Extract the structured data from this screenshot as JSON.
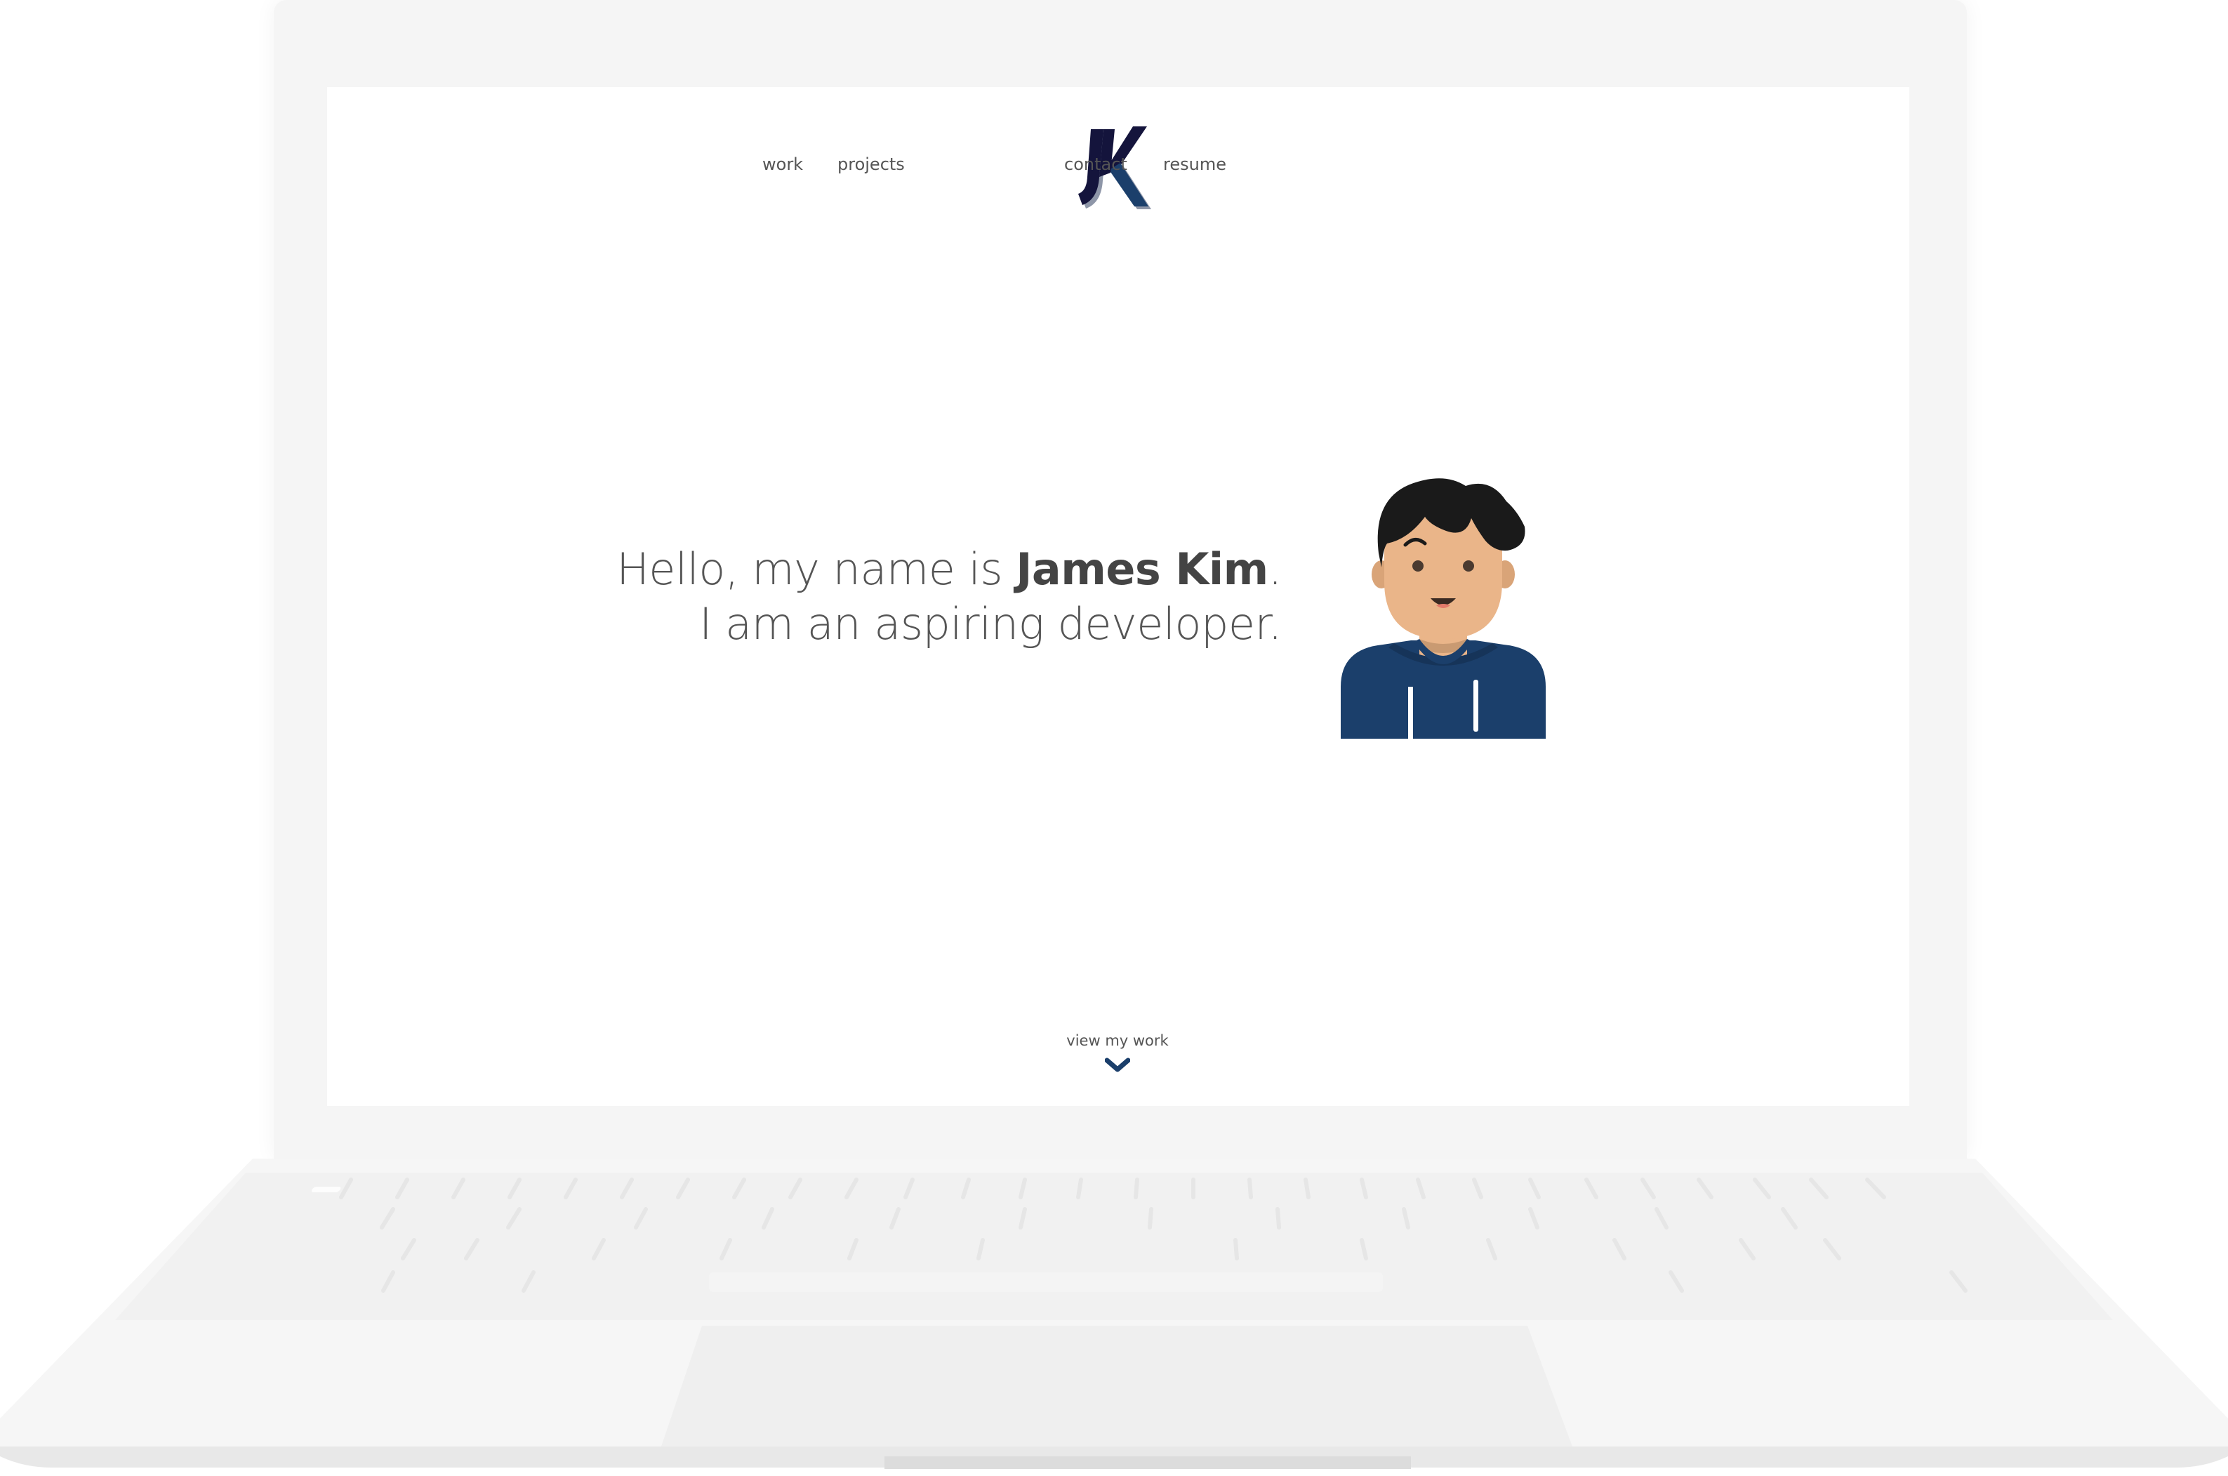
{
  "nav": {
    "items": [
      {
        "label": "work"
      },
      {
        "label": "projects"
      },
      {
        "label": "contact"
      },
      {
        "label": "resume"
      }
    ],
    "logo_text": "JK"
  },
  "hero": {
    "line1_prefix": "Hello, my name is ",
    "name": "James Kim",
    "line1_suffix": ".",
    "line2": "I am an aspiring developer."
  },
  "cta": {
    "label": "view my work",
    "icon": "chevron-down-icon"
  },
  "colors": {
    "accent": "#1b3f6b",
    "logo_dark": "#14143c",
    "text": "#555555",
    "skin": "#eab589",
    "hoodie": "#1b3f6b",
    "hair": "#1a1a1a"
  }
}
